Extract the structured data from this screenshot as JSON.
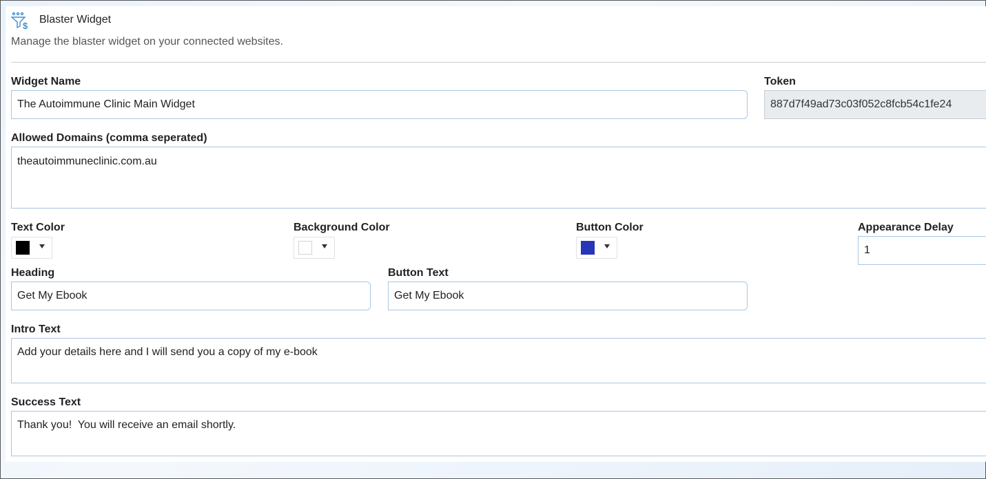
{
  "header": {
    "icon": "funnel-dollar-icon",
    "title": "Blaster Widget",
    "subtitle": "Manage the blaster widget on your connected websites."
  },
  "form": {
    "widget_name": {
      "label": "Widget Name",
      "value": "The Autoimmune Clinic Main Widget"
    },
    "token": {
      "label": "Token",
      "value": "887d7f49ad73c03f052c8fcb54c1fe24"
    },
    "allowed_domains": {
      "label": "Allowed Domains (comma seperated)",
      "value": "theautoimmuneclinic.com.au"
    },
    "text_color": {
      "label": "Text Color",
      "color": "#000000"
    },
    "background_color": {
      "label": "Background Color",
      "color": "#ffffff"
    },
    "button_color": {
      "label": "Button Color",
      "color": "#2636b8"
    },
    "appearance_delay": {
      "label": "Appearance Delay",
      "value": "1"
    },
    "heading": {
      "label": "Heading",
      "value": "Get My Ebook"
    },
    "button_text": {
      "label": "Button Text",
      "value": "Get My Ebook"
    },
    "intro_text": {
      "label": "Intro Text",
      "value": "Add your details here and I will send you a copy of my e-book"
    },
    "success_text": {
      "label": "Success Text",
      "value": "Thank you!  You will receive an email shortly."
    }
  },
  "colors": {
    "accent": "#3a8fd6",
    "border": "#a9c6e2"
  }
}
